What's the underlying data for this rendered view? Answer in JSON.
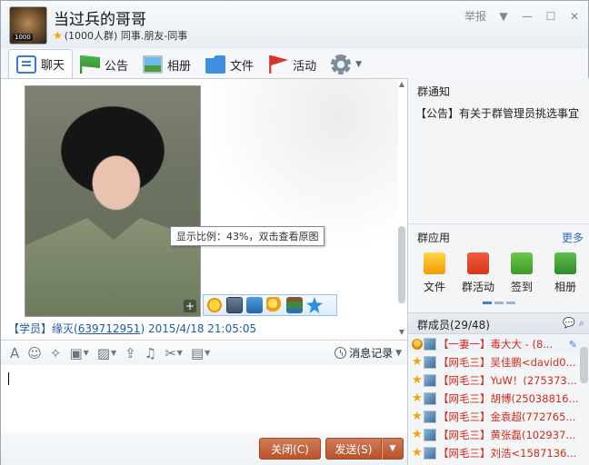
{
  "window": {
    "group_name": "当过兵的哥哥",
    "group_meta": "(1000人群) 同事.朋友-同事",
    "avatar_badge": "1000",
    "report_label": "举报",
    "min_icon": "minimize-icon",
    "max_icon": "maximize-icon",
    "close_icon": "close-icon"
  },
  "tabs": [
    {
      "label": "聊天",
      "icon": "chat-icon"
    },
    {
      "label": "公告",
      "icon": "notice-flag-icon"
    },
    {
      "label": "相册",
      "icon": "album-icon"
    },
    {
      "label": "文件",
      "icon": "folder-icon"
    },
    {
      "label": "活动",
      "icon": "activity-flag-icon"
    }
  ],
  "chat": {
    "tooltip": "显示比例：43%，双击查看原图",
    "sender_role": "【学员】",
    "sender_name": "缘灭",
    "sender_qq": "639712951",
    "time": " 2015/4/18 21:05:05"
  },
  "toolbar": {
    "history_label": "消息记录"
  },
  "buttons": {
    "close": "关闭(C)",
    "send": "发送(S)"
  },
  "right_panel": {
    "notice_title": "群通知",
    "notice_text": "【公告】有关于群管理员挑选事宜",
    "apps_title": "群应用",
    "more": "更多",
    "apps": [
      {
        "label": "文件"
      },
      {
        "label": "群活动"
      },
      {
        "label": "签到"
      },
      {
        "label": "相册"
      }
    ],
    "members_title": "群成员(29/48)",
    "members": [
      {
        "tag": "【一妻一】",
        "name": "毒大大 - (8..."
      },
      {
        "tag": "【网毛三】",
        "name": "吴佳鹏<david0..."
      },
      {
        "tag": "【网毛三】",
        "name": "YuW！(275373..."
      },
      {
        "tag": "【网毛三】",
        "name": "胡博(25038816..."
      },
      {
        "tag": "【网毛三】",
        "name": "金袁超(772765..."
      },
      {
        "tag": "【网毛三】",
        "name": "黄张磊(102937..."
      },
      {
        "tag": "【网毛三】",
        "name": "刘浩<1587136..."
      }
    ]
  }
}
